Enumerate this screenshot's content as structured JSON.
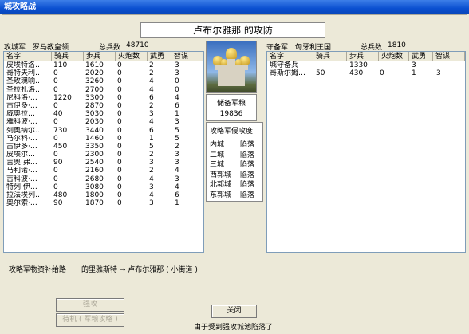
{
  "window": {
    "title": "城攻略战"
  },
  "castle_title": "卢布尔雅那 的攻防",
  "attack": {
    "label": "攻城军",
    "commander": "罗马教皇领",
    "total_label": "总兵数",
    "total": "48710",
    "columns": [
      "名字",
      "骑兵",
      "步兵",
      "火炮数",
      "武勇",
      "智谋"
    ],
    "rows": [
      [
        "皮埃特洛…",
        "110",
        "1610",
        "0",
        "2",
        "3"
      ],
      [
        "哥特夫利…",
        "0",
        "2020",
        "0",
        "2",
        "3"
      ],
      [
        "圣玫瑰响…",
        "0",
        "3260",
        "0",
        "4",
        "0"
      ],
      [
        "圣拉扎洛…",
        "0",
        "2700",
        "0",
        "4",
        "0"
      ],
      [
        "尼科洛·…",
        "1220",
        "3300",
        "0",
        "6",
        "4"
      ],
      [
        "古伊多·…",
        "0",
        "2870",
        "0",
        "2",
        "6"
      ],
      [
        "威奥拉…",
        "40",
        "3030",
        "0",
        "3",
        "1"
      ],
      [
        "雅科波·…",
        "0",
        "2030",
        "0",
        "4",
        "3"
      ],
      [
        "列奥纳尔…",
        "730",
        "3440",
        "0",
        "6",
        "5"
      ],
      [
        "马尔科·…",
        "0",
        "1460",
        "0",
        "1",
        "5"
      ],
      [
        "古伊多·…",
        "450",
        "3350",
        "0",
        "5",
        "2"
      ],
      [
        "皮埃尔…",
        "0",
        "2300",
        "0",
        "2",
        "3"
      ],
      [
        "吉奥·弗…",
        "90",
        "2540",
        "0",
        "3",
        "3"
      ],
      [
        "马利诺·…",
        "0",
        "2160",
        "0",
        "2",
        "4"
      ],
      [
        "吉科波·…",
        "0",
        "2680",
        "0",
        "4",
        "3"
      ],
      [
        "特列·伊…",
        "0",
        "3080",
        "0",
        "3",
        "4"
      ],
      [
        "拉法埃列…",
        "480",
        "1800",
        "0",
        "4",
        "6"
      ],
      [
        "奥尔索·…",
        "90",
        "1870",
        "0",
        "3",
        "1"
      ]
    ]
  },
  "defense": {
    "label": "守备军",
    "commander": "匈牙利王国",
    "total_label": "总兵数",
    "total": "1810",
    "columns": [
      "名字",
      "骑兵",
      "步兵",
      "火炮数",
      "武勇",
      "智谋"
    ],
    "rows": [
      [
        "城守备兵",
        "",
        "1330",
        "",
        "3",
        ""
      ],
      [
        "哥斯尔姆…",
        "50",
        "430",
        "0",
        "1",
        "3"
      ]
    ]
  },
  "reserve": {
    "label": "储备军粮",
    "value": "19836"
  },
  "progress": {
    "title": "攻略军侵攻度",
    "items": [
      [
        "内城",
        "陷落"
      ],
      [
        "二城",
        "陷落"
      ],
      [
        "三城",
        "陷落"
      ],
      [
        "西郭城",
        "陷落"
      ],
      [
        "北郭城",
        "陷落"
      ],
      [
        "东郭城",
        "陷落"
      ]
    ]
  },
  "supply": {
    "label": "攻略军物资补给路",
    "route": "的里雅斯特 → 卢布尔雅那 ( 小街道 )"
  },
  "buttons": {
    "assault": "强攻",
    "wait": "待机 ( 军粮攻略 )",
    "close": "关闭"
  },
  "status_message": "由于受到强攻城池陷落了"
}
